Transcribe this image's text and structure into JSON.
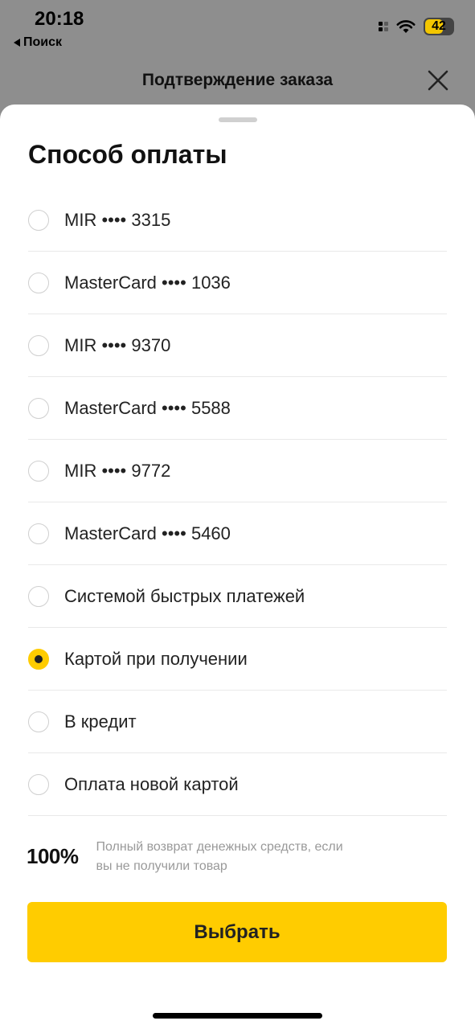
{
  "status_bar": {
    "time": "20:18",
    "back_label": "Поиск",
    "battery": "42"
  },
  "header": {
    "title": "Подтверждение заказа"
  },
  "sheet": {
    "title": "Способ оплаты",
    "options": [
      {
        "label": "MIR •••• 3315",
        "selected": false
      },
      {
        "label": "MasterCard •••• 1036",
        "selected": false
      },
      {
        "label": "MIR •••• 9370",
        "selected": false
      },
      {
        "label": "MasterCard •••• 5588",
        "selected": false
      },
      {
        "label": "MIR •••• 9772",
        "selected": false
      },
      {
        "label": "MasterCard •••• 5460",
        "selected": false
      },
      {
        "label": "Системой быстрых платежей",
        "selected": false
      },
      {
        "label": "Картой при получении",
        "selected": true
      },
      {
        "label": "В кредит",
        "selected": false
      },
      {
        "label": "Оплата новой картой",
        "selected": false
      }
    ],
    "guarantee_value": "100%",
    "guarantee_text": "Полный возврат денежных средств, если вы не получили товар",
    "choose_button": "Выбрать"
  },
  "colors": {
    "accent": "#ffcc00",
    "overlay": "#8e8e8e"
  }
}
